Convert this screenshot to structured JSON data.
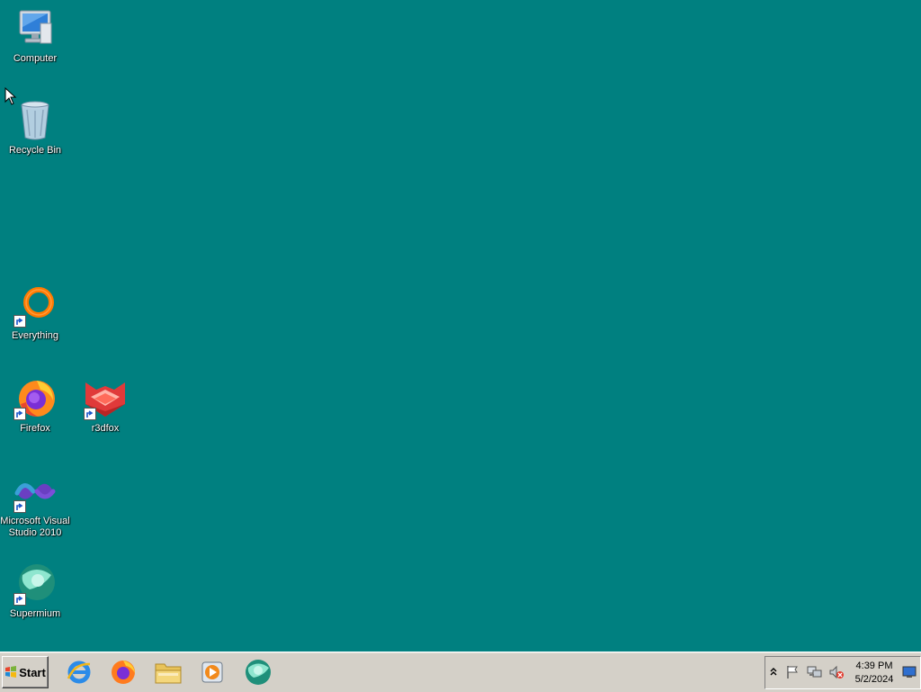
{
  "desktop": {
    "background_color": "#008080",
    "icons": {
      "computer": {
        "label": "Computer",
        "icon": "computer-icon"
      },
      "recycle_bin": {
        "label": "Recycle Bin",
        "icon": "recycle-bin-icon"
      },
      "everything": {
        "label": "Everything",
        "icon": "everything-icon",
        "shortcut": true
      },
      "firefox": {
        "label": "Firefox",
        "icon": "firefox-icon",
        "shortcut": true
      },
      "r3dfox": {
        "label": "r3dfox",
        "icon": "r3dfox-icon",
        "shortcut": true
      },
      "visual_studio": {
        "label_line1": "Microsoft Visual",
        "label_line2": "Studio 2010",
        "icon": "visual-studio-icon",
        "shortcut": true
      },
      "supermium": {
        "label": "Supermium",
        "icon": "supermium-icon",
        "shortcut": true
      }
    }
  },
  "taskbar": {
    "start_label": "Start",
    "pinned": [
      "internet-explorer-icon",
      "firefox-icon",
      "file-explorer-icon",
      "media-player-icon",
      "supermium-icon"
    ],
    "tray": {
      "icons": [
        "show-hidden-icons-chevron",
        "action-center-flag-icon",
        "network-icon",
        "volume-muted-icon"
      ],
      "time": "4:39 PM",
      "date": "5/2/2024"
    }
  }
}
